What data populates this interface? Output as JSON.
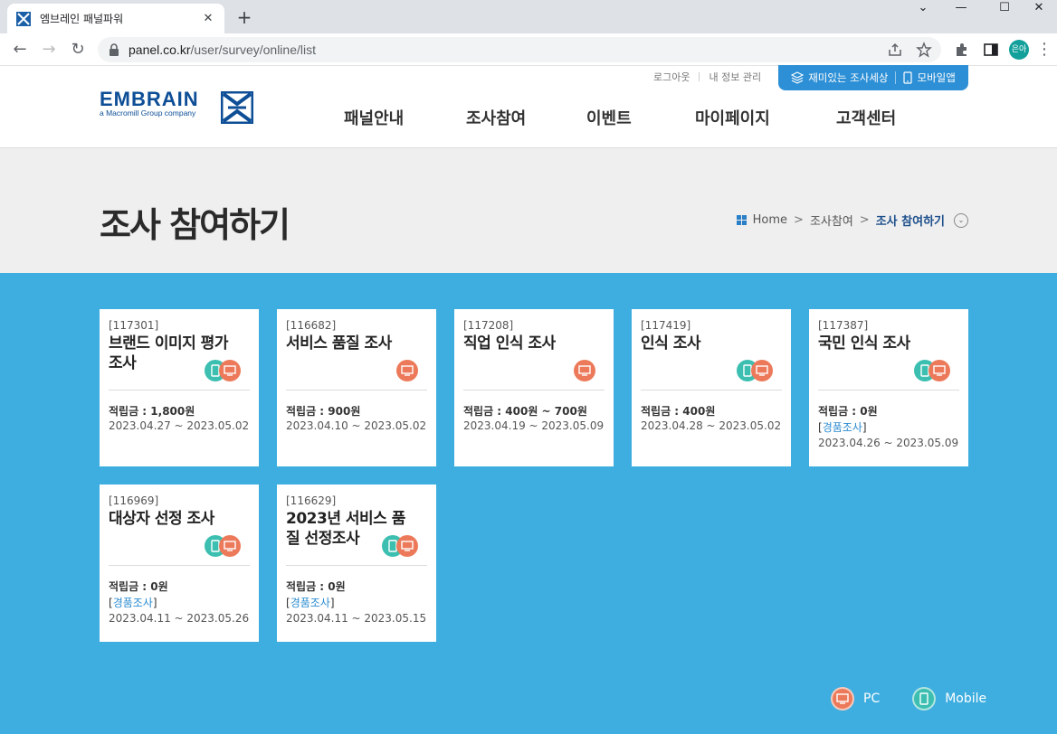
{
  "browser": {
    "tab_title": "엠브레인 패널파워",
    "url_host": "panel.co.kr",
    "url_path": "/user/survey/online/list",
    "profile": "은아"
  },
  "header": {
    "logo_text": "EMBRAIN",
    "logo_sub": "a Macromill Group company",
    "util_links": [
      "로그아웃",
      "내 정보 관리"
    ],
    "util_fun": "재미있는 조사세상",
    "util_mobile": "모바일앱",
    "nav": [
      "패널안내",
      "조사참여",
      "이벤트",
      "마이페이지",
      "고객센터"
    ]
  },
  "page": {
    "title": "조사 참여하기",
    "breadcrumb": [
      "Home",
      "조사참여",
      "조사 참여하기"
    ]
  },
  "colors": {
    "accent_blue": "#3eaee0",
    "mobile_badge": "#3cbfb0",
    "pc_badge": "#ec7a5a",
    "brand": "#0d4e96"
  },
  "reward_label": "적립금 : ",
  "surveys": [
    {
      "id": "[117301]",
      "title": "브랜드 이미지 평가 조사",
      "reward": "1,800원",
      "period": "2023.04.27 ~ 2023.05.02",
      "devices": [
        "mobile",
        "pc"
      ],
      "tag": ""
    },
    {
      "id": "[116682]",
      "title": "서비스 품질 조사",
      "reward": "900원",
      "period": "2023.04.10 ~ 2023.05.02",
      "devices": [
        "pc"
      ],
      "tag": ""
    },
    {
      "id": "[117208]",
      "title": "직업 인식 조사",
      "reward": "400원 ~ 700원",
      "period": "2023.04.19 ~ 2023.05.09",
      "devices": [
        "pc"
      ],
      "tag": ""
    },
    {
      "id": "[117419]",
      "title": "인식 조사",
      "reward": "400원",
      "period": "2023.04.28 ~ 2023.05.02",
      "devices": [
        "mobile",
        "pc"
      ],
      "tag": ""
    },
    {
      "id": "[117387]",
      "title": "국민 인식 조사",
      "reward": "0원",
      "period": "2023.04.26 ~ 2023.05.09",
      "devices": [
        "mobile",
        "pc"
      ],
      "tag": "경품조사"
    },
    {
      "id": "[116969]",
      "title": "대상자 선정 조사",
      "reward": "0원",
      "period": "2023.04.11 ~ 2023.05.26",
      "devices": [
        "mobile",
        "pc"
      ],
      "tag": "경품조사"
    },
    {
      "id": "[116629]",
      "title": "2023년 서비스 품질 선정조사",
      "reward": "0원",
      "period": "2023.04.11 ~ 2023.05.15",
      "devices": [
        "mobile",
        "pc"
      ],
      "tag": "경품조사"
    }
  ],
  "legend": {
    "pc": "PC",
    "mobile": "Mobile"
  }
}
